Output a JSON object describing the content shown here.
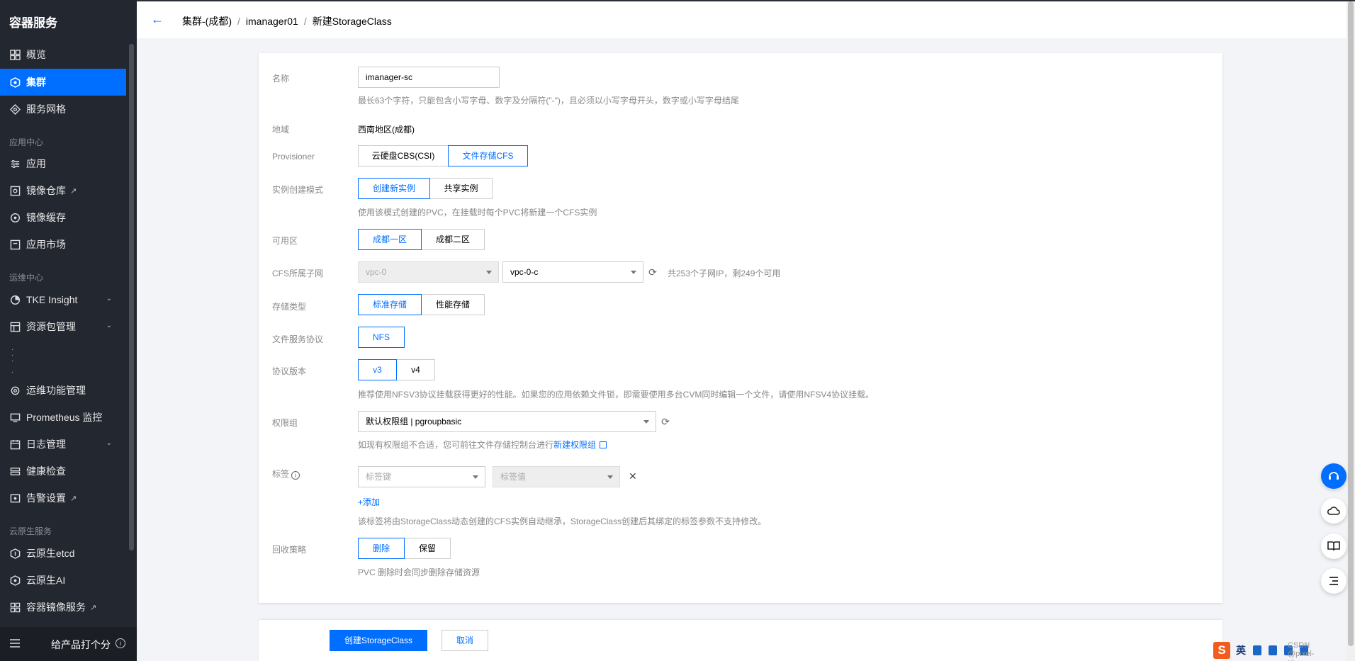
{
  "sidebar": {
    "title": "容器服务",
    "items_top": [
      {
        "label": "概览",
        "icon": "grid-icon",
        "active": false
      },
      {
        "label": "集群",
        "icon": "cluster-icon",
        "active": true
      },
      {
        "label": "服务网格",
        "icon": "mesh-icon",
        "active": false
      }
    ],
    "section_app": "应用中心",
    "items_app": [
      {
        "label": "应用",
        "icon": "app-icon"
      },
      {
        "label": "镜像仓库",
        "icon": "image-repo-icon",
        "external": true
      },
      {
        "label": "镜像缓存",
        "icon": "image-cache-icon"
      },
      {
        "label": "应用市场",
        "icon": "market-icon"
      }
    ],
    "section_ops": "运维中心",
    "items_ops": [
      {
        "label": "TKE Insight",
        "icon": "insight-icon",
        "expandable": true
      },
      {
        "label": "资源包管理",
        "icon": "package-icon",
        "expandable": true
      },
      {
        "label": "运维功能管理",
        "icon": "ops-icon"
      },
      {
        "label": "Prometheus 监控",
        "icon": "monitor-icon"
      },
      {
        "label": "日志管理",
        "icon": "log-icon",
        "expandable": true
      },
      {
        "label": "健康检查",
        "icon": "health-icon"
      },
      {
        "label": "告警设置",
        "icon": "alarm-icon",
        "external": true
      }
    ],
    "section_native": "云原生服务",
    "items_native": [
      {
        "label": "云原生etcd",
        "icon": "etcd-icon"
      },
      {
        "label": "云原生AI",
        "icon": "ai-icon"
      },
      {
        "label": "容器镜像服务",
        "icon": "registry-icon",
        "external": true
      }
    ],
    "footer_label": "给产品打个分"
  },
  "header": {
    "crumb1": "集群-(成都)",
    "crumb2": "imanager01",
    "crumb3": "新建StorageClass",
    "sep": "/"
  },
  "form": {
    "name": {
      "label": "名称",
      "value": "imanager-sc",
      "help": "最长63个字符，只能包含小写字母、数字及分隔符(\"-\")，且必须以小写字母开头，数字或小写字母结尾"
    },
    "region": {
      "label": "地域",
      "value": "西南地区(成都)"
    },
    "provisioner": {
      "label": "Provisioner",
      "options": [
        "云硬盘CBS(CSI)",
        "文件存储CFS"
      ],
      "selected": "文件存储CFS"
    },
    "instance_mode": {
      "label": "实例创建模式",
      "options": [
        "创建新实例",
        "共享实例"
      ],
      "selected": "创建新实例",
      "help": "使用该模式创建的PVC，在挂载时每个PVC将新建一个CFS实例"
    },
    "zone": {
      "label": "可用区",
      "options": [
        "成都一区",
        "成都二区"
      ],
      "selected": "成都一区"
    },
    "subnet": {
      "label": "CFS所属子网",
      "vpc": "vpc-0",
      "subnet": "vpc-0-c",
      "help": "共253个子网IP，剩249个可用"
    },
    "storage_type": {
      "label": "存储类型",
      "options": [
        "标准存储",
        "性能存储"
      ],
      "selected": "标准存储"
    },
    "protocol": {
      "label": "文件服务协议",
      "options": [
        "NFS"
      ],
      "selected": "NFS"
    },
    "version": {
      "label": "协议版本",
      "options": [
        "v3",
        "v4"
      ],
      "selected": "v3",
      "help": "推荐使用NFSV3协议挂载获得更好的性能。如果您的应用依赖文件锁，即需要使用多台CVM同时编辑一个文件，请使用NFSV4协议挂载。"
    },
    "perm_group": {
      "label": "权限组",
      "value": "默认权限组 | pgroupbasic",
      "help_prefix": "如现有权限组不合适，您可前往文件存储控制台进行",
      "help_link": "新建权限组"
    },
    "tags": {
      "label": "标签",
      "key_placeholder": "标签键",
      "value_placeholder": "标签值",
      "add_label": "添加",
      "help": "该标签将由StorageClass动态创建的CFS实例自动继承，StorageClass创建后其绑定的标签参数不支持修改。"
    },
    "reclaim": {
      "label": "回收策略",
      "options": [
        "删除",
        "保留"
      ],
      "selected": "删除",
      "help": "PVC 删除时会同步删除存储资源"
    }
  },
  "actions": {
    "create": "创建StorageClass",
    "cancel": "取消"
  },
  "ime": {
    "lang": "英",
    "watermark": "CSDN @pixel-ui"
  },
  "colors": {
    "accent": "#006eff",
    "sidebar_bg": "#232730"
  }
}
